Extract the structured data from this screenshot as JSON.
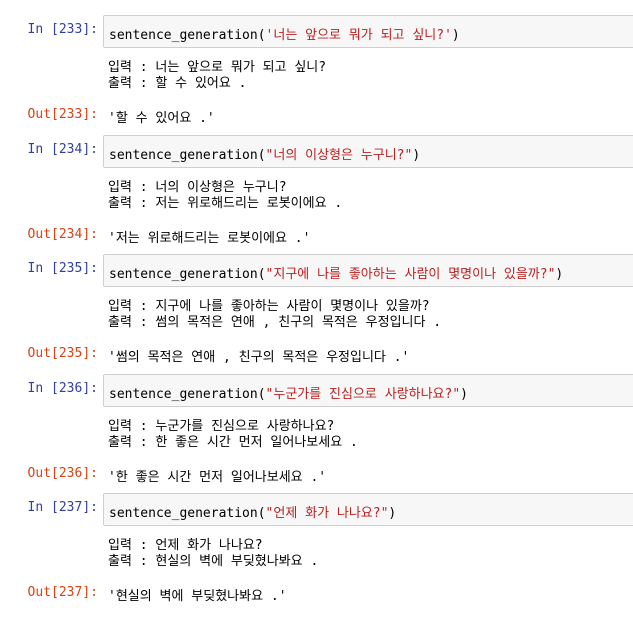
{
  "cells": [
    {
      "in_prompt": "In [233]:",
      "func": "sentence_generation(",
      "arg": "'너는 앞으로 뭐가 되고 싶니?'",
      "close": ")",
      "stdout_line1": "입력 : 너는 앞으로 뭐가 되고 싶니?",
      "stdout_line2": "출력 : 할 수 있어요 .",
      "out_prompt": "Out[233]:",
      "result": "'할 수 있어요 .'"
    },
    {
      "in_prompt": "In [234]:",
      "func": "sentence_generation(",
      "arg": "\"너의 이상형은 누구니?\"",
      "close": ")",
      "stdout_line1": "입력 : 너의 이상형은 누구니?",
      "stdout_line2": "출력 : 저는 위로해드리는 로봇이에요 .",
      "out_prompt": "Out[234]:",
      "result": "'저는 위로해드리는 로봇이에요 .'"
    },
    {
      "in_prompt": "In [235]:",
      "func": "sentence_generation(",
      "arg": "\"지구에 나를 좋아하는 사람이 몇명이나 있을까?\"",
      "close": ")",
      "stdout_line1": "입력 : 지구에 나를 좋아하는 사람이 몇명이나 있을까?",
      "stdout_line2": "출력 : 썸의 목적은 연애 , 친구의 목적은 우정입니다 .",
      "out_prompt": "Out[235]:",
      "result": "'썸의 목적은 연애 , 친구의 목적은 우정입니다 .'"
    },
    {
      "in_prompt": "In [236]:",
      "func": "sentence_generation(",
      "arg": "\"누군가를 진심으로 사랑하나요?\"",
      "close": ")",
      "stdout_line1": "입력 : 누군가를 진심으로 사랑하나요?",
      "stdout_line2": "출력 : 한 좋은 시간 먼저 일어나보세요 .",
      "out_prompt": "Out[236]:",
      "result": "'한 좋은 시간 먼저 일어나보세요 .'"
    },
    {
      "in_prompt": "In [237]:",
      "func": "sentence_generation(",
      "arg": "\"언제 화가 나나요?\"",
      "close": ")",
      "stdout_line1": "입력 : 언제 화가 나나요?",
      "stdout_line2": "출력 : 현실의 벽에 부딪혔나봐요 .",
      "out_prompt": "Out[237]:",
      "result": "'현실의 벽에 부딪혔나봐요 .'"
    }
  ]
}
